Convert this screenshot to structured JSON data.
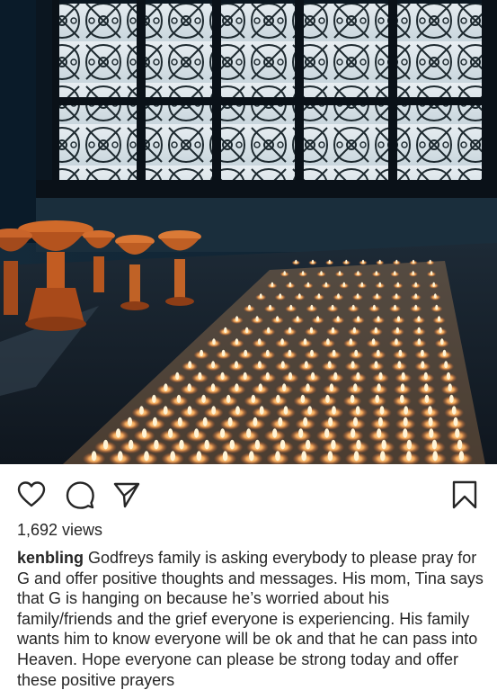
{
  "post": {
    "media": {
      "description_icon": "video-thumbnail"
    },
    "actions": {
      "like_icon": "heart-icon",
      "comment_icon": "comment-icon",
      "share_icon": "send-icon",
      "save_icon": "bookmark-icon"
    },
    "views_text": "1,692 views",
    "caption": {
      "username": "kenbling",
      "text": "Godfreys family is asking everybody to please pray for G and offer positive thoughts and messages.  His mom, Tina says that G is hanging on because he’s worried about his family/friends and the grief everyone is experiencing.  His family wants him to know everyone will be ok and that he can pass into Heaven.  Hope everyone can please be strong today and offer these positive prayers"
    }
  }
}
